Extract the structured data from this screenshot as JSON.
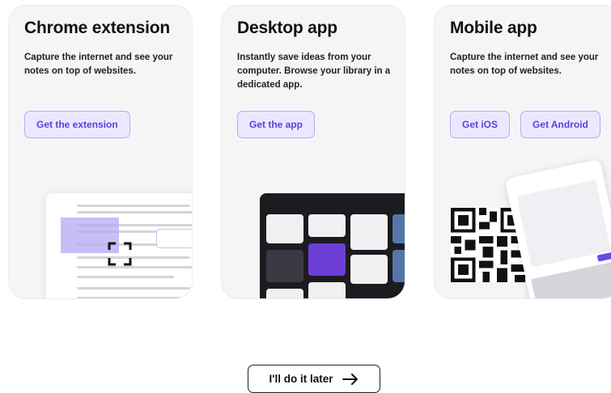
{
  "cards": {
    "chrome": {
      "title": "Chrome extension",
      "description": "Capture the internet and see your notes on top of websites.",
      "button": "Get the extension"
    },
    "desktop": {
      "title": "Desktop app",
      "description": "Instantly save ideas from your computer. Browse your library in a dedicated app.",
      "button": "Get the app"
    },
    "mobile": {
      "title": "Mobile app",
      "description": "Capture the internet and see your notes on top of websites.",
      "button_ios": "Get iOS",
      "button_android": "Get Android"
    }
  },
  "footer": {
    "later_label": "I'll do it later",
    "arrow_icon": "arrow-right-icon"
  },
  "colors": {
    "accent": "#5b3fe0",
    "button_bg": "#ece7fe",
    "button_border": "#b7a8f5",
    "card_bg": "#f5f5f6"
  }
}
